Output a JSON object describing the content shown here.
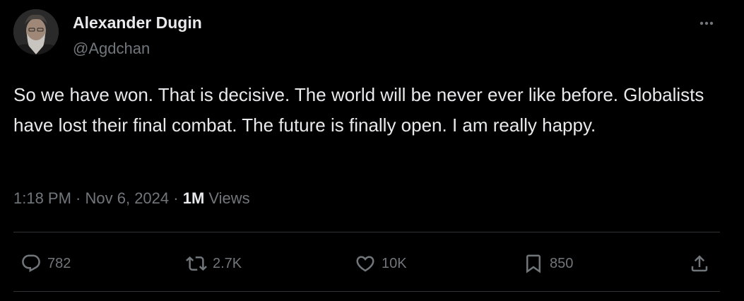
{
  "author": {
    "name": "Alexander Dugin",
    "handle": "@Agdchan"
  },
  "tweet": {
    "text": "So we have won. That is decisive. The world will be never ever like before. Globalists have lost their final combat. The future is finally open. I am really happy."
  },
  "meta": {
    "time": "1:18 PM",
    "separator": " · ",
    "date": "Nov 6, 2024",
    "views_count": "1M",
    "views_label": " Views"
  },
  "actions": {
    "reply_count": "782",
    "repost_count": "2.7K",
    "like_count": "10K",
    "bookmark_count": "850"
  },
  "icons": {
    "more": "more-icon",
    "reply": "reply-icon",
    "repost": "repost-icon",
    "like": "heart-icon",
    "bookmark": "bookmark-icon",
    "share": "share-icon"
  },
  "colors": {
    "background": "#000000",
    "primary_text": "#e7e9ea",
    "secondary_text": "#71767b",
    "divider": "#2f3336"
  }
}
